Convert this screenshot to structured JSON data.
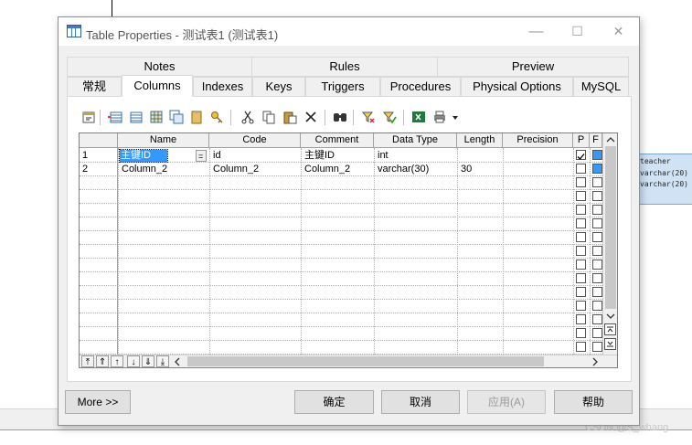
{
  "background": {
    "entity_rows": [
      "teacher",
      "varchar(20)",
      "varchar(20)"
    ],
    "watermark": "CSDN @S_whang"
  },
  "dialog": {
    "title": "Table Properties - 测试表1 (测试表1)",
    "window_controls": {
      "minimize": "—",
      "maximize": "☐",
      "close": "✕"
    }
  },
  "tabs": {
    "top_row": [
      "Notes",
      "Rules",
      "Preview"
    ],
    "bottom_row": [
      "常规",
      "Columns",
      "Indexes",
      "Keys",
      "Triggers",
      "Procedures",
      "Physical Options",
      "MySQL"
    ],
    "active": "Columns"
  },
  "toolbar": {
    "icons": [
      "properties-icon",
      "insert-row-icon",
      "add-row-icon",
      "add-columns-icon",
      "replicate-icon",
      "paste-column-icon",
      "key-icon",
      "cut-icon",
      "copy-icon",
      "paste-icon",
      "delete-icon",
      "find-icon",
      "filter-icon",
      "customize-columns-icon",
      "excel-icon",
      "print-icon",
      "dropdown-icon"
    ]
  },
  "grid": {
    "headers": [
      "Name",
      "Code",
      "Comment",
      "Data Type",
      "Length",
      "Precision",
      "P",
      "F"
    ],
    "rows": [
      {
        "num": "1",
        "name": "主键ID",
        "code": "id",
        "comment": "主键ID",
        "data_type": "int",
        "length": "",
        "precision": "",
        "primary": true
      },
      {
        "num": "2",
        "name": "Column_2",
        "code": "Column_2",
        "comment": "Column_2",
        "data_type": "varchar(30)",
        "length": "30",
        "precision": "",
        "primary": false
      }
    ],
    "name_cell_button": "="
  },
  "buttons": {
    "more": "More >>",
    "ok": "确定",
    "cancel": "取消",
    "apply": "应用(A)",
    "help": "帮助"
  },
  "colors": {
    "selection": "#3399ff",
    "dialog_bg": "#f0f0f0",
    "entity_bg": "#cfe3f5"
  }
}
